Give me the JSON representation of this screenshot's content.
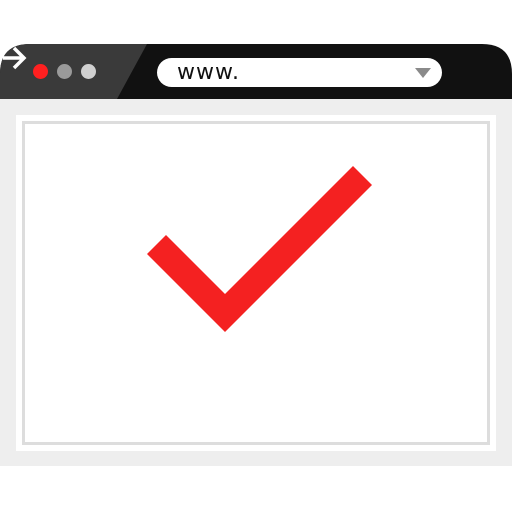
{
  "browser": {
    "url_text": "www.",
    "colors": {
      "titlebar": "#111111",
      "tab_shape": "#3a3a3a",
      "close_dot": "#ff2020",
      "minimize_dot": "#9a9a9a",
      "maximize_dot": "#d0d0d0",
      "viewport_bg": "#eeeeee",
      "checkmark": "#f42121"
    },
    "icons": {
      "window_controls": [
        "close-dot",
        "minimize-dot",
        "maximize-dot"
      ],
      "dropdown": "chevron-down-icon",
      "go": "arrow-right-icon",
      "content": "checkmark-icon"
    }
  }
}
